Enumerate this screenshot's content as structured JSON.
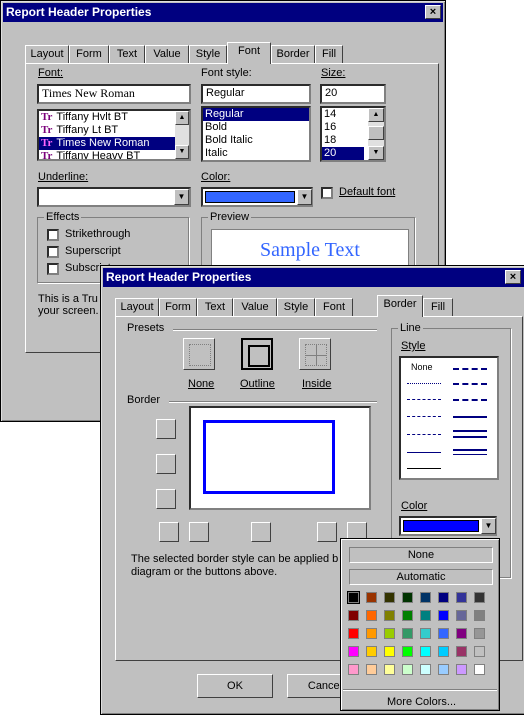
{
  "font_dialog": {
    "title": "Report Header Properties",
    "close": "×",
    "tabs": [
      "Layout",
      "Form",
      "Text",
      "Value",
      "Style",
      "Font",
      "Border",
      "Fill"
    ],
    "active_tab": "Font",
    "font_label": "Font:",
    "font_value": "Times New Roman",
    "font_list": [
      {
        "icon": "Tr",
        "name": "Tiffany Hvlt BT"
      },
      {
        "icon": "Tr",
        "name": "Tiffany Lt BT"
      },
      {
        "icon": "Tr",
        "name": "Times New Roman"
      },
      {
        "icon": "Tr",
        "name": "Tiffany Heavy BT"
      }
    ],
    "style_label": "Font style:",
    "style_value": "Regular",
    "style_list": [
      "Regular",
      "Bold",
      "Bold Italic",
      "Italic"
    ],
    "size_label": "Size:",
    "size_value": "20",
    "size_list": [
      "14",
      "16",
      "18",
      "20"
    ],
    "underline_label": "Underline:",
    "color_label": "Color:",
    "color_value": "#3366ff",
    "default_font_label": "Default font",
    "effects_label": "Effects",
    "effects": [
      "Strikethrough",
      "Superscript",
      "Subscript"
    ],
    "preview_label": "Preview",
    "preview_text": "Sample Text",
    "info_line1": "This is a Tru",
    "info_line2": "your screen."
  },
  "border_dialog": {
    "title": "Report Header Properties",
    "close": "×",
    "tabs": [
      "Layout",
      "Form",
      "Text",
      "Value",
      "Style",
      "Font",
      "Border",
      "Fill"
    ],
    "active_tab": "Border",
    "presets_label": "Presets",
    "presets": [
      "None",
      "Outline",
      "Inside"
    ],
    "border_label": "Border",
    "line_label": "Line",
    "style_label": "Style",
    "style_none": "None",
    "color_label": "Color",
    "color_value": "#0000ff",
    "hint_line1": "The selected border style can be applied b",
    "hint_line2": "diagram or the buttons above.",
    "ok": "OK",
    "cancel": "Cancel"
  },
  "color_popup": {
    "none": "None",
    "automatic": "Automatic",
    "more": "More Colors...",
    "colors": [
      "#000000",
      "#993300",
      "#333300",
      "#003300",
      "#003366",
      "#000080",
      "#333399",
      "#333333",
      "#800000",
      "#ff6600",
      "#808000",
      "#008000",
      "#008080",
      "#0000ff",
      "#666699",
      "#808080",
      "#ff0000",
      "#ff9900",
      "#99cc00",
      "#339966",
      "#33cccc",
      "#3366ff",
      "#800080",
      "#969696",
      "#ff00ff",
      "#ffcc00",
      "#ffff00",
      "#00ff00",
      "#00ffff",
      "#00ccff",
      "#993366",
      "#c0c0c0",
      "#ff99cc",
      "#ffcc99",
      "#ffff99",
      "#ccffcc",
      "#ccffff",
      "#99ccff",
      "#cc99ff",
      "#ffffff"
    ]
  }
}
